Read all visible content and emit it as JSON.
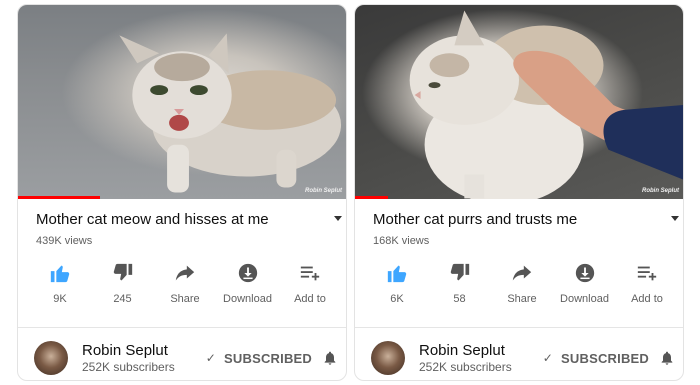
{
  "colors": {
    "accent_blue": "#3ea6ff",
    "progress_red": "#ff0000",
    "text_secondary": "#606060"
  },
  "videos": [
    {
      "watermark": "Robin Seplut",
      "progress": 0.25,
      "title": "Mother cat meow and hisses at me",
      "views": "439K views",
      "actions": {
        "like": "9K",
        "dislike": "245",
        "share": "Share",
        "download": "Download",
        "add_to": "Add to"
      },
      "channel": {
        "name": "Robin Seplut",
        "subscribers": "252K subscribers",
        "status": "SUBSCRIBED"
      }
    },
    {
      "watermark": "Robin Seplut",
      "progress": 0.1,
      "title": "Mother cat purrs and trusts me",
      "views": "168K views",
      "actions": {
        "like": "6K",
        "dislike": "58",
        "share": "Share",
        "download": "Download",
        "add_to": "Add to"
      },
      "channel": {
        "name": "Robin Seplut",
        "subscribers": "252K subscribers",
        "status": "SUBSCRIBED"
      }
    }
  ]
}
